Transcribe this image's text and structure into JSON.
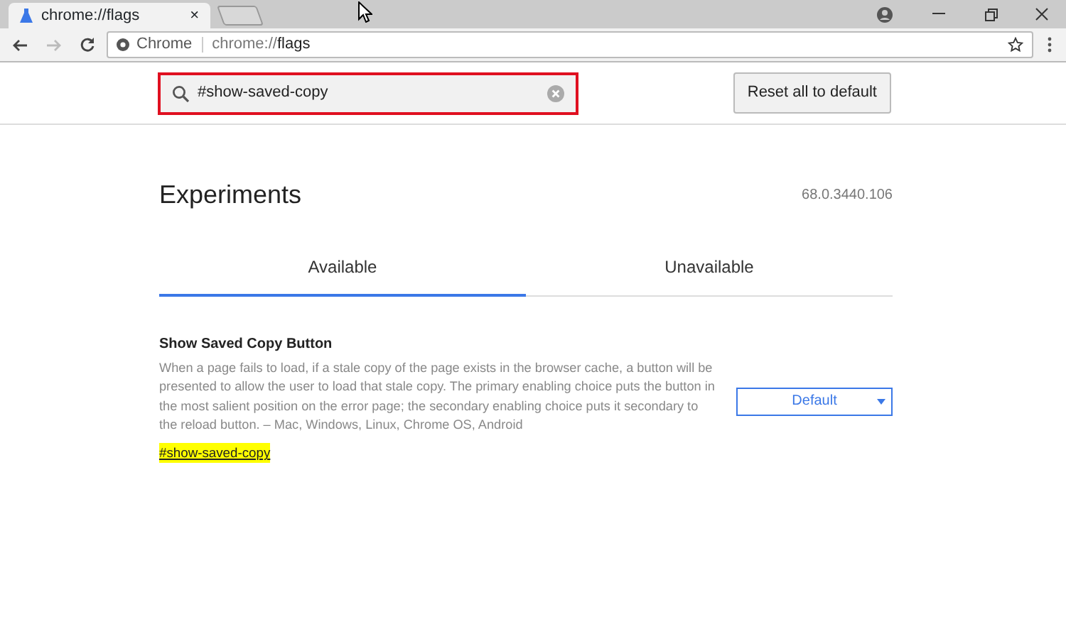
{
  "tab": {
    "title": "chrome://flags",
    "close": "×"
  },
  "address_bar": {
    "site_label": "Chrome",
    "url_prefix": "chrome://",
    "url_path": "flags"
  },
  "search": {
    "value": "#show-saved-copy",
    "annotated": true
  },
  "reset_button": "Reset all to default",
  "page": {
    "title": "Experiments",
    "version": "68.0.3440.106"
  },
  "tabs": [
    {
      "label": "Available",
      "selected": true
    },
    {
      "label": "Unavailable",
      "selected": false
    }
  ],
  "experiments": [
    {
      "name": "Show Saved Copy Button",
      "description": "When a page fails to load, if a stale copy of the page exists in the browser cache, a button will be presented to allow the user to load that stale copy. The primary enabling choice puts the button in the most salient position on the error page; the secondary enabling choice puts it secondary to the reload button. – Mac, Windows, Linux, Chrome OS, Android",
      "link": "#show-saved-copy",
      "highlighted": true,
      "choice": "Default"
    }
  ]
}
